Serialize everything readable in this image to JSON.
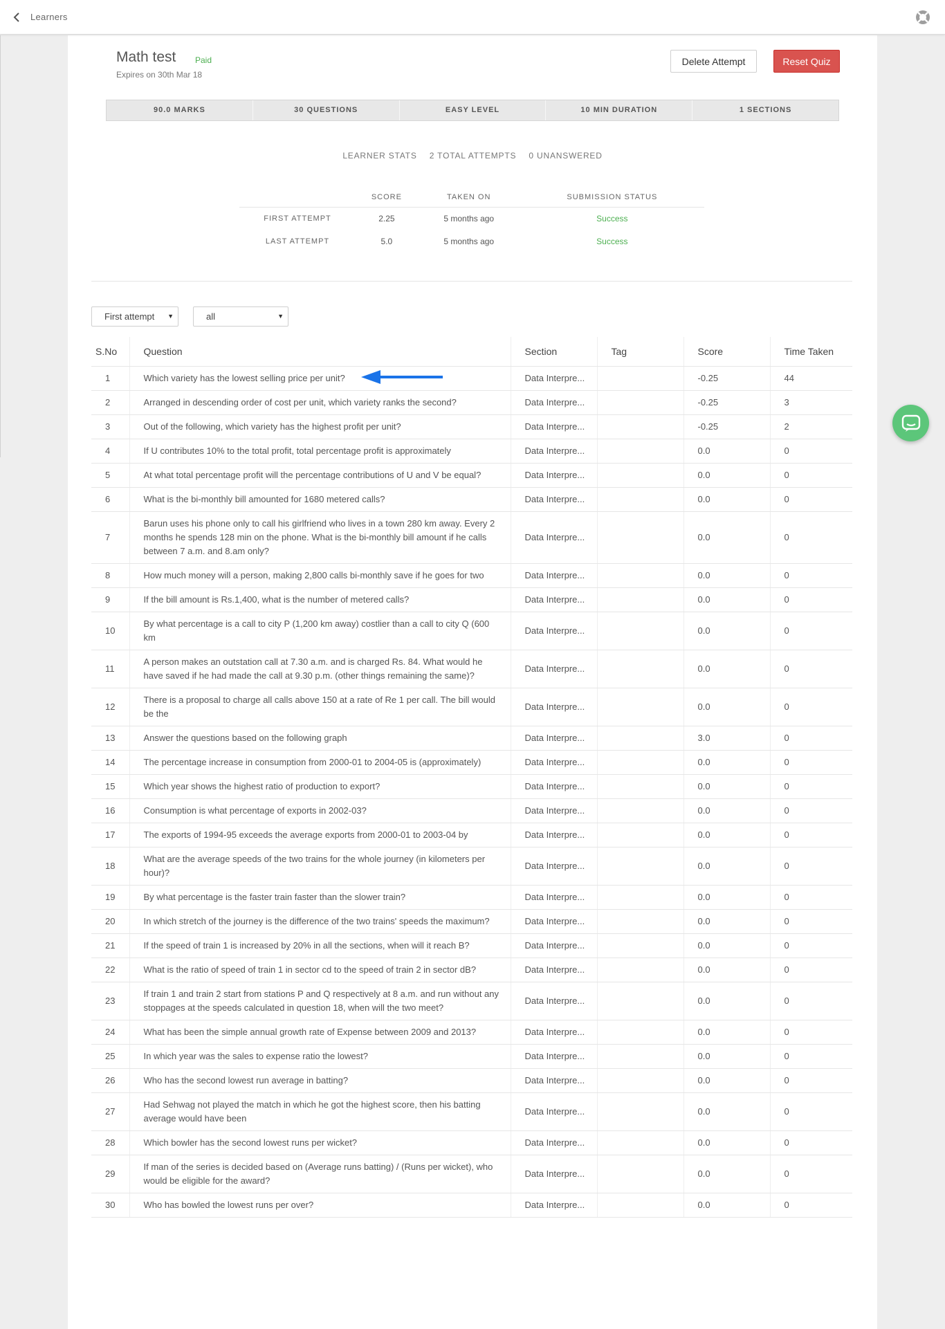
{
  "header": {
    "back_label": "Learners",
    "help_icon": "lifebuoy-icon"
  },
  "quiz": {
    "title": "Math test",
    "badge": "Paid",
    "expires": "Expires on 30th Mar 18",
    "delete_label": "Delete Attempt",
    "reset_label": "Reset Quiz",
    "info": [
      "90.0 MARKS",
      "30 QUESTIONS",
      "EASY LEVEL",
      "10 MIN DURATION",
      "1 SECTIONS"
    ]
  },
  "stats": {
    "learner_stats": "LEARNER STATS",
    "total_attempts": "2 TOTAL ATTEMPTS",
    "unanswered": "0 UNANSWERED",
    "columns": [
      "SCORE",
      "TAKEN ON",
      "SUBMISSION STATUS"
    ],
    "rows": [
      {
        "label": "FIRST ATTEMPT",
        "score": "2.25",
        "taken_on": "5 months ago",
        "status": "Success"
      },
      {
        "label": "LAST ATTEMPT",
        "score": "5.0",
        "taken_on": "5 months ago",
        "status": "Success"
      }
    ]
  },
  "filters": {
    "attempt": "First attempt",
    "type": "all"
  },
  "table": {
    "headers": [
      "S.No",
      "Question",
      "Section",
      "Tag",
      "Score",
      "Time Taken"
    ],
    "rows": [
      {
        "no": "1",
        "q": "Which variety has the lowest selling price per unit?",
        "sec": "Data Interpre...",
        "tag": "",
        "score": "-0.25",
        "time": "44"
      },
      {
        "no": "2",
        "q": "Arranged in descending order of cost per unit, which variety ranks the second?",
        "sec": "Data Interpre...",
        "tag": "",
        "score": "-0.25",
        "time": "3"
      },
      {
        "no": "3",
        "q": "Out of the following, which variety has the highest profit per unit?",
        "sec": "Data Interpre...",
        "tag": "",
        "score": "-0.25",
        "time": "2"
      },
      {
        "no": "4",
        "q": "If U contributes 10% to the total profit, total percentage profit is approximately",
        "sec": "Data Interpre...",
        "tag": "",
        "score": "0.0",
        "time": "0"
      },
      {
        "no": "5",
        "q": "At what total percentage profit will the percentage contributions of U and V be equal?",
        "sec": "Data Interpre...",
        "tag": "",
        "score": "0.0",
        "time": "0"
      },
      {
        "no": "6",
        "q": "What is the bi-monthly bill amounted for 1680 metered calls?",
        "sec": "Data Interpre...",
        "tag": "",
        "score": "0.0",
        "time": "0"
      },
      {
        "no": "7",
        "q": "Barun uses his phone only to call his girlfriend who lives in a town 280 km away. Every 2 months he spends 128 min on the phone. What is the bi-monthly bill amount if he calls between 7 a.m. and 8.am only?",
        "sec": "Data Interpre...",
        "tag": "",
        "score": "0.0",
        "time": "0"
      },
      {
        "no": "8",
        "q": "How much money will a person, making 2,800 calls bi-monthly save if he goes for two",
        "sec": "Data Interpre...",
        "tag": "",
        "score": "0.0",
        "time": "0"
      },
      {
        "no": "9",
        "q": "If the bill amount is Rs.1,400, what is the number of metered calls?",
        "sec": "Data Interpre...",
        "tag": "",
        "score": "0.0",
        "time": "0"
      },
      {
        "no": "10",
        "q": "By what percentage is a call to city P (1,200 km away) costlier than a call to city Q (600 km",
        "sec": "Data Interpre...",
        "tag": "",
        "score": "0.0",
        "time": "0"
      },
      {
        "no": "11",
        "q": "A person makes an outstation call at 7.30 a.m. and is charged Rs. 84. What would he have saved if he had made the call at 9.30 p.m. (other things remaining the same)?",
        "sec": "Data Interpre...",
        "tag": "",
        "score": "0.0",
        "time": "0"
      },
      {
        "no": "12",
        "q": "There is a proposal to charge all calls above 150 at a rate of Re 1 per call. The bill would be the",
        "sec": "Data Interpre...",
        "tag": "",
        "score": "0.0",
        "time": "0"
      },
      {
        "no": "13",
        "q": "Answer the questions based on the following graph",
        "sec": "Data Interpre...",
        "tag": "",
        "score": "3.0",
        "time": "0"
      },
      {
        "no": "14",
        "q": "The percentage increase in consumption from 2000-01 to 2004-05 is (approximately)",
        "sec": "Data Interpre...",
        "tag": "",
        "score": "0.0",
        "time": "0"
      },
      {
        "no": "15",
        "q": "Which year shows the highest ratio of production to export?",
        "sec": "Data Interpre...",
        "tag": "",
        "score": "0.0",
        "time": "0"
      },
      {
        "no": "16",
        "q": "Consumption is what percentage of exports in 2002-03?",
        "sec": "Data Interpre...",
        "tag": "",
        "score": "0.0",
        "time": "0"
      },
      {
        "no": "17",
        "q": "The exports of 1994-95 exceeds the average exports from 2000-01 to 2003-04 by",
        "sec": "Data Interpre...",
        "tag": "",
        "score": "0.0",
        "time": "0"
      },
      {
        "no": "18",
        "q": "What are the average speeds of the two trains for the whole journey (in kilometers per hour)?",
        "sec": "Data Interpre...",
        "tag": "",
        "score": "0.0",
        "time": "0"
      },
      {
        "no": "19",
        "q": "By what percentage is the faster train faster than the slower train?",
        "sec": "Data Interpre...",
        "tag": "",
        "score": "0.0",
        "time": "0"
      },
      {
        "no": "20",
        "q": "In which stretch of the journey is the difference of the two trains' speeds the maximum?",
        "sec": "Data Interpre...",
        "tag": "",
        "score": "0.0",
        "time": "0"
      },
      {
        "no": "21",
        "q": "If the speed of train 1 is increased by 20% in all the sections, when will it reach B?",
        "sec": "Data Interpre...",
        "tag": "",
        "score": "0.0",
        "time": "0"
      },
      {
        "no": "22",
        "q": "What is the ratio of speed of train 1 in sector cd to the speed of train 2 in sector dB?",
        "sec": "Data Interpre...",
        "tag": "",
        "score": "0.0",
        "time": "0"
      },
      {
        "no": "23",
        "q": "If train 1 and train 2 start from stations P and Q respectively at 8 a.m. and run without any stoppages at the speeds calculated in question 18, when will the two meet?",
        "sec": "Data Interpre...",
        "tag": "",
        "score": "0.0",
        "time": "0"
      },
      {
        "no": "24",
        "q": "What has been the simple annual growth rate of Expense between 2009 and 2013?",
        "sec": "Data Interpre...",
        "tag": "",
        "score": "0.0",
        "time": "0"
      },
      {
        "no": "25",
        "q": "In which year was the sales to expense ratio the lowest?",
        "sec": "Data Interpre...",
        "tag": "",
        "score": "0.0",
        "time": "0"
      },
      {
        "no": "26",
        "q": "Who has the second lowest run average in batting?",
        "sec": "Data Interpre...",
        "tag": "",
        "score": "0.0",
        "time": "0"
      },
      {
        "no": "27",
        "q": "Had Sehwag not played the match in which he got the highest score, then his batting average would have been",
        "sec": "Data Interpre...",
        "tag": "",
        "score": "0.0",
        "time": "0"
      },
      {
        "no": "28",
        "q": "Which bowler has the second lowest runs per wicket?",
        "sec": "Data Interpre...",
        "tag": "",
        "score": "0.0",
        "time": "0"
      },
      {
        "no": "29",
        "q": "If man of the series is decided based on (Average runs batting) / (Runs per wicket), who would be eligible for the award?",
        "sec": "Data Interpre...",
        "tag": "",
        "score": "0.0",
        "time": "0"
      },
      {
        "no": "30",
        "q": "Who has bowled the lowest runs per over?",
        "sec": "Data Interpre...",
        "tag": "",
        "score": "0.0",
        "time": "0"
      }
    ]
  },
  "colors": {
    "success": "#4caf50",
    "danger": "#d9534f",
    "arrow": "#1a73e8",
    "chat": "#5cc67a"
  },
  "icons": {
    "chat": "chat-bubble-icon",
    "arrow": "arrow-left-icon"
  }
}
